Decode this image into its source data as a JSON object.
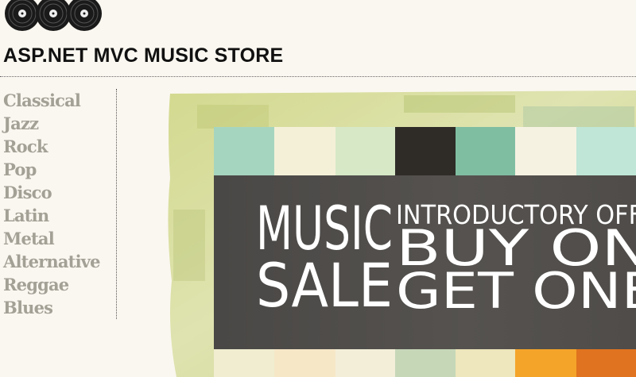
{
  "header": {
    "title": "ASP.NET MVC MUSIC STORE",
    "logo_icon": "vinyl-records-icon"
  },
  "genres": [
    {
      "label": "Classical"
    },
    {
      "label": "Jazz"
    },
    {
      "label": "Rock"
    },
    {
      "label": "Pop"
    },
    {
      "label": "Disco"
    },
    {
      "label": "Latin"
    },
    {
      "label": "Metal"
    },
    {
      "label": "Alternative"
    },
    {
      "label": "Reggae"
    },
    {
      "label": "Blues"
    }
  ],
  "promo": {
    "word_music": "MUSIC",
    "word_sale": "SALE",
    "line_offer": "INTRODUCTORY OFF",
    "line_buy": "BUY ON",
    "line_get": "GET ONE"
  },
  "colors": {
    "page_background": "#faf7f0",
    "genre_link": "#a3a096",
    "banner_panel": "#4a4846"
  }
}
